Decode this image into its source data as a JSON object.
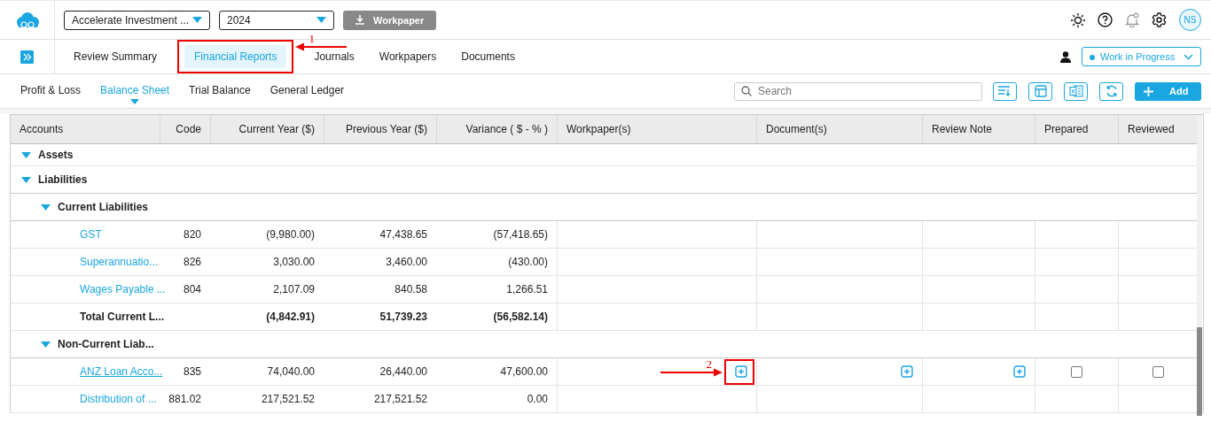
{
  "header": {
    "company_select": "Accelerate Investment ...",
    "year_select": "2024",
    "workpaper_button": "Workpaper",
    "avatar": "NS"
  },
  "nav_tabs": [
    {
      "label": "Review Summary",
      "selected": false
    },
    {
      "label": "Financial Reports",
      "selected": true
    },
    {
      "label": "Journals",
      "selected": false
    },
    {
      "label": "Workpapers",
      "selected": false
    },
    {
      "label": "Documents",
      "selected": false
    }
  ],
  "status_select": "Work in Progress",
  "report_tabs": [
    {
      "label": "Profit & Loss",
      "selected": false
    },
    {
      "label": "Balance Sheet",
      "selected": true
    },
    {
      "label": "Trial Balance",
      "selected": false
    },
    {
      "label": "General Ledger",
      "selected": false
    }
  ],
  "search": {
    "placeholder": "Search"
  },
  "add_button": "Add",
  "table": {
    "columns": [
      "Accounts",
      "Code",
      "Current Year ($)",
      "Previous Year ($)",
      "Variance ( $ - % )",
      "Workpaper(s)",
      "Document(s)",
      "Review Note",
      "Prepared",
      "Reviewed"
    ],
    "rows": [
      {
        "account": "Assets",
        "kind": "group",
        "expanded": true
      },
      {
        "account": "Liabilities",
        "kind": "group",
        "expanded": true,
        "children": [
          {
            "account": "Current Liabilities",
            "kind": "group",
            "expanded": true,
            "children": [
              {
                "account": "GST",
                "kind": "account",
                "code": "820",
                "current": "(9,980.00)",
                "previous": "47,438.65",
                "variance": "(57,418.65)"
              },
              {
                "account": "Superannuatio...",
                "kind": "account",
                "code": "826",
                "current": "3,030.00",
                "previous": "3,460.00",
                "variance": "(430.00)"
              },
              {
                "account": "Wages Payable ...",
                "kind": "account",
                "code": "804",
                "current": "2,107.09",
                "previous": "840.58",
                "variance": "1,266.51"
              },
              {
                "account": "Total Current L...",
                "kind": "total",
                "current": "(4,842.91)",
                "previous": "51,739.23",
                "variance": "(56,582.14)"
              }
            ]
          },
          {
            "account": "Non-Current Liab...",
            "kind": "group",
            "expanded": true,
            "children": [
              {
                "account": "ANZ Loan Acco...",
                "kind": "account",
                "underlined": true,
                "code": "835",
                "current": "74,040.00",
                "previous": "26,440.00",
                "variance": "47,600.00",
                "actions": {
                  "prepared": false,
                  "reviewed": false
                }
              },
              {
                "account": "Distribution of ...",
                "kind": "account",
                "code": "881.02",
                "current": "217,521.52",
                "previous": "217,521.52",
                "variance": "0.00"
              }
            ]
          }
        ]
      }
    ]
  },
  "annotations": [
    {
      "label": "1"
    },
    {
      "label": "2"
    }
  ]
}
